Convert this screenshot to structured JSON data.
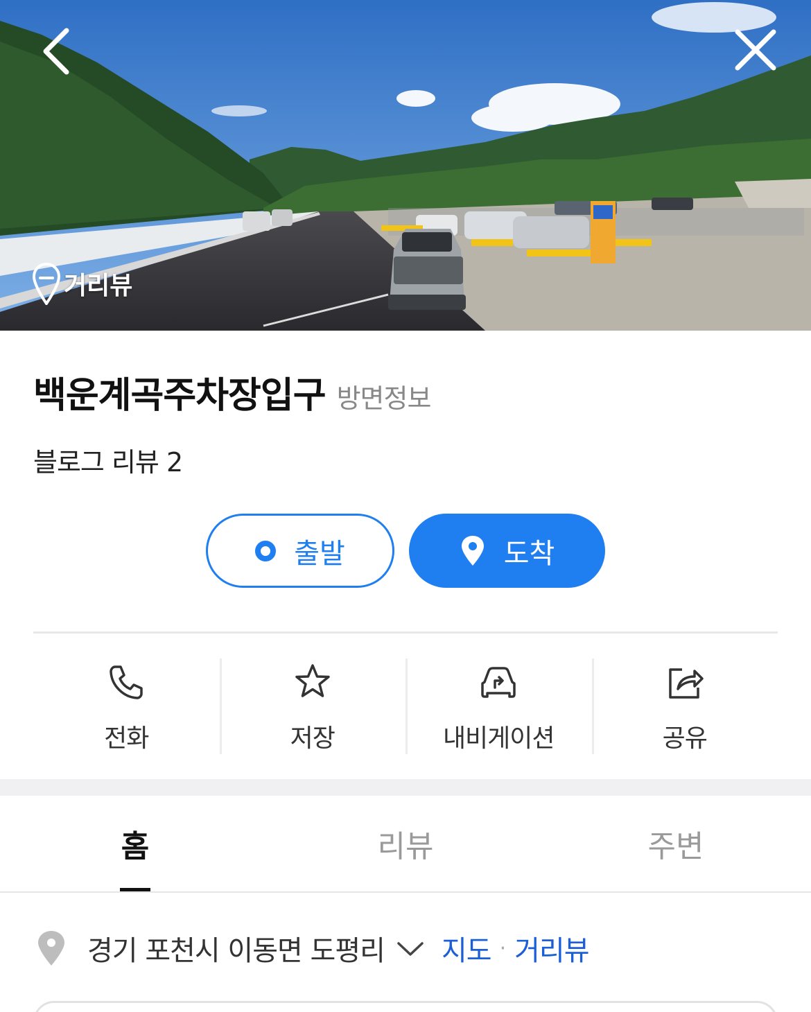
{
  "hero": {
    "back_icon": "chevron-left-icon",
    "close_icon": "close-icon",
    "streetview_label": "거리뷰",
    "sky_color": "#3b78c8"
  },
  "place": {
    "name": "백운계곡주차장입구",
    "direction_info": "방면정보",
    "review_line": "블로그 리뷰 2"
  },
  "route": {
    "depart_label": "출발",
    "arrive_label": "도착",
    "accent": "#1f7ef0"
  },
  "actions": [
    {
      "label": "전화",
      "icon": "phone-icon"
    },
    {
      "label": "저장",
      "icon": "star-icon"
    },
    {
      "label": "내비게이션",
      "icon": "car-navigation-icon"
    },
    {
      "label": "공유",
      "icon": "share-icon"
    }
  ],
  "tabs": [
    {
      "label": "홈",
      "active": true
    },
    {
      "label": "리뷰",
      "active": false
    },
    {
      "label": "주변",
      "active": false
    }
  ],
  "address": {
    "text": "경기 포천시 이동면 도평리",
    "map_link": "지도",
    "separator": "·",
    "streetview_link": "거리뷰",
    "link_color": "#1a5fd6"
  }
}
